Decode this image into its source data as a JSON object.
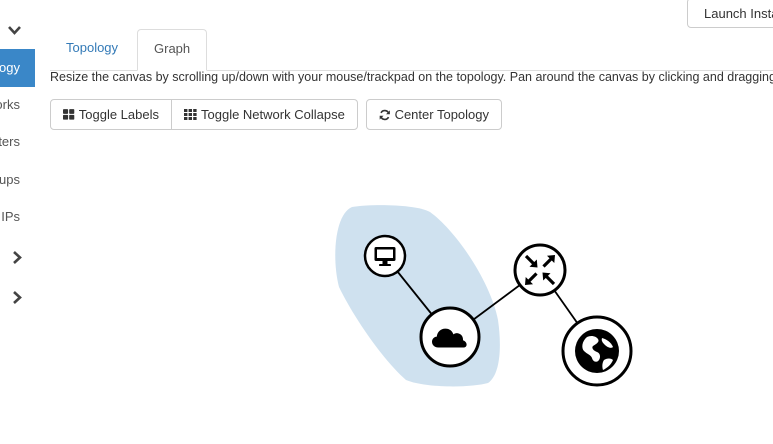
{
  "sidebar": {
    "items": [
      {
        "label": "Topology",
        "active": true
      },
      {
        "label": "Networks",
        "active": false
      },
      {
        "label": "Routers",
        "active": false
      },
      {
        "label": "Security Groups",
        "active": false
      },
      {
        "label": "Floating IPs",
        "active": false
      }
    ]
  },
  "header": {
    "launch_label": "Launch Instance"
  },
  "tabs": [
    {
      "label": "Topology",
      "active": false
    },
    {
      "label": "Graph",
      "active": true
    }
  ],
  "help_text": "Resize the canvas by scrolling up/down with your mouse/trackpad on the topology. Pan around the canvas by clicking and dragging the space behind the topology.",
  "toolbar": {
    "toggle_labels": "Toggle Labels",
    "toggle_collapse": "Toggle Network Collapse",
    "center_topology": "Center Topology"
  },
  "topology": {
    "nodes": [
      "instance-node",
      "network-node",
      "router-node",
      "external-network-node"
    ],
    "colors": {
      "network_hull": "#cfe1ef",
      "node_stroke": "#000000",
      "node_fill": "#ffffff"
    }
  }
}
